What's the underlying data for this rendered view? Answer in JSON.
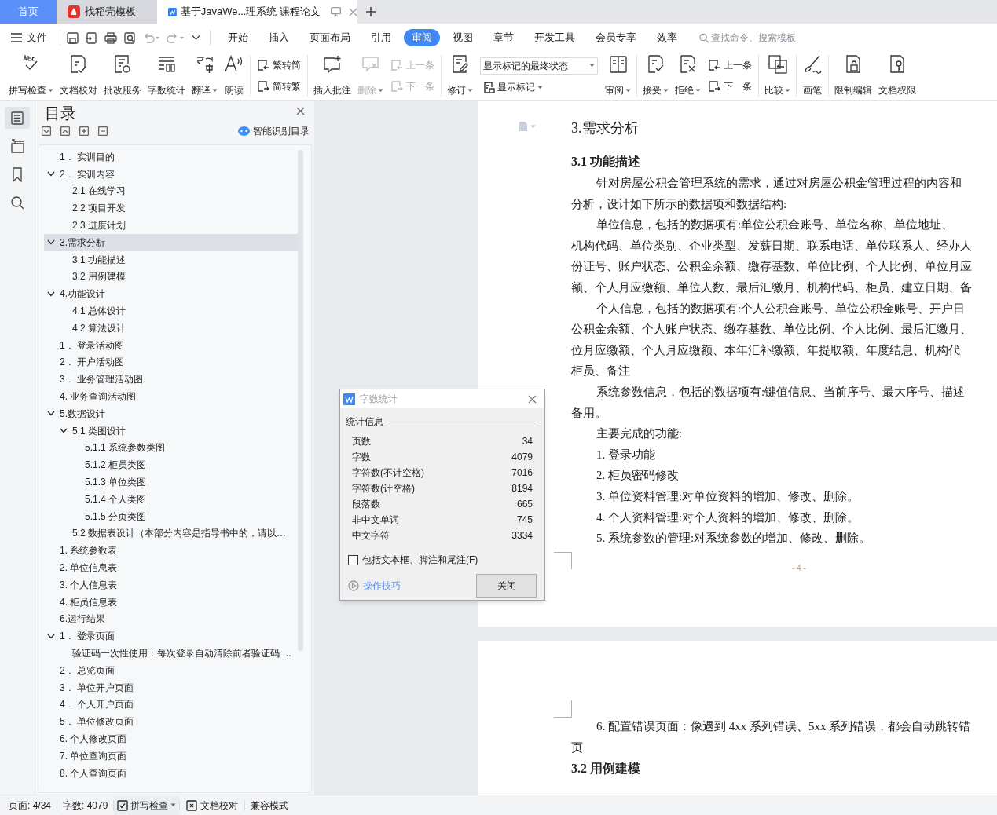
{
  "tabs": [
    {
      "label": "首页",
      "kind": "home",
      "selected": false
    },
    {
      "label": "找稻壳模板",
      "kind": "docer",
      "selected": false
    },
    {
      "label": "基于JavaWe...理系统 课程论文",
      "kind": "document",
      "selected": true
    }
  ],
  "menu": {
    "file": "文件",
    "tabs": [
      {
        "label": "开始",
        "selected": false
      },
      {
        "label": "插入",
        "selected": false
      },
      {
        "label": "页面布局",
        "selected": false
      },
      {
        "label": "引用",
        "selected": false
      },
      {
        "label": "审阅",
        "selected": true
      },
      {
        "label": "视图",
        "selected": false
      },
      {
        "label": "章节",
        "selected": false
      },
      {
        "label": "开发工具",
        "selected": false
      },
      {
        "label": "会员专享",
        "selected": false
      },
      {
        "label": "效率",
        "selected": false
      }
    ],
    "search": {
      "placeholder": "查找命令、搜索模板"
    }
  },
  "ribbon": [
    [
      {
        "kind": "big",
        "label": "拼写检查",
        "dropdown": true,
        "disabled": false
      },
      {
        "kind": "big",
        "label": "文档校对",
        "dropdown": false,
        "disabled": false
      },
      {
        "kind": "big",
        "label": "批改服务",
        "dropdown": false,
        "disabled": false
      },
      {
        "kind": "big",
        "label": "字数统计",
        "dropdown": false,
        "disabled": false
      },
      {
        "kind": "big",
        "label": "翻译",
        "dropdown": true,
        "disabled": false
      },
      {
        "kind": "big",
        "label": "朗读",
        "dropdown": false,
        "disabled": false
      }
    ],
    [
      {
        "kind": "pair",
        "items": [
          {
            "label": "繁转简",
            "disabled": false
          },
          {
            "label": "简转繁",
            "disabled": false
          }
        ]
      }
    ],
    [
      {
        "kind": "big",
        "label": "插入批注",
        "dropdown": false,
        "disabled": false
      },
      {
        "kind": "big",
        "label": "删除",
        "dropdown": true,
        "disabled": true
      },
      {
        "kind": "pair",
        "items": [
          {
            "label": "上一条",
            "disabled": true
          },
          {
            "label": "下一条",
            "disabled": true
          }
        ]
      }
    ],
    [
      {
        "kind": "big",
        "label": "修订",
        "dropdown": true,
        "disabled": false
      },
      {
        "kind": "select",
        "value": "显示标记的最终状态",
        "below": {
          "label": "显示标记",
          "dropdown": true
        }
      },
      {
        "kind": "big",
        "label": "审阅",
        "dropdown": true,
        "disabled": false
      }
    ],
    [
      {
        "kind": "big",
        "label": "接受",
        "dropdown": true,
        "disabled": false
      },
      {
        "kind": "big",
        "label": "拒绝",
        "dropdown": true,
        "disabled": false
      },
      {
        "kind": "pair",
        "items": [
          {
            "label": "上一条",
            "disabled": false
          },
          {
            "label": "下一条",
            "disabled": false
          }
        ]
      }
    ],
    [
      {
        "kind": "big",
        "label": "比较",
        "dropdown": true,
        "disabled": false
      }
    ],
    [
      {
        "kind": "big",
        "label": "画笔",
        "dropdown": false,
        "disabled": false
      }
    ],
    [
      {
        "kind": "big",
        "label": "限制编辑",
        "dropdown": false,
        "disabled": false
      },
      {
        "kind": "big",
        "label": "文档权限",
        "dropdown": false,
        "disabled": false
      }
    ]
  ],
  "nav_rail": [
    {
      "selected": true
    },
    {
      "selected": false
    },
    {
      "selected": false
    },
    {
      "selected": false
    }
  ],
  "toc": {
    "title": "目录",
    "smart_button": "智能识别目录",
    "items": [
      {
        "label": "1． 实训目的",
        "selected": false
      },
      {
        "label": "2． 实训内容",
        "selected": false,
        "expanded": true,
        "children": [
          {
            "label": "2.1 在线学习",
            "selected": false
          },
          {
            "label": "2.2 项目开发",
            "selected": false
          },
          {
            "label": "2.3 进度计划",
            "selected": false
          }
        ]
      },
      {
        "label": "3.需求分析",
        "selected": true,
        "expanded": true,
        "children": [
          {
            "label": "3.1 功能描述",
            "selected": false
          },
          {
            "label": "3.2 用例建模",
            "selected": false
          }
        ]
      },
      {
        "label": "4.功能设计",
        "selected": false,
        "expanded": true,
        "children": [
          {
            "label": "4.1 总体设计",
            "selected": false
          },
          {
            "label": "4.2 算法设计",
            "selected": false
          }
        ]
      },
      {
        "label": "1． 登录活动图",
        "selected": false
      },
      {
        "label": "2． 开户活动图",
        "selected": false
      },
      {
        "label": "3． 业务管理活动图",
        "selected": false
      },
      {
        "label": "4. 业务查询活动图",
        "selected": false
      },
      {
        "label": "5.数据设计",
        "selected": false,
        "expanded": true,
        "children": [
          {
            "label": "5.1 类图设计",
            "selected": false,
            "expanded": true,
            "children": [
              {
                "label": "5.1.1 系统参数类图",
                "selected": false
              },
              {
                "label": "5.1.2 柜员类图",
                "selected": false
              },
              {
                "label": "5.1.3 单位类图",
                "selected": false
              },
              {
                "label": "5.1.4 个人类图",
                "selected": false
              },
              {
                "label": "5.1.5 分页类图",
                "selected": false
              }
            ]
          },
          {
            "label": "5.2 数据表设计（本部分内容是指导书中的，请以…",
            "selected": false
          }
        ]
      },
      {
        "label": "1. 系统参数表",
        "selected": false
      },
      {
        "label": "2. 单位信息表",
        "selected": false
      },
      {
        "label": "3. 个人信息表",
        "selected": false
      },
      {
        "label": "4. 柜员信息表",
        "selected": false
      },
      {
        "label": "6.运行结果",
        "selected": false
      },
      {
        "label": "1． 登录页面",
        "selected": false,
        "expanded": true,
        "children": [
          {
            "label": "验证码一次性使用：每次登录自动清除前者验证码 …",
            "selected": false
          }
        ]
      },
      {
        "label": "2． 总览页面",
        "selected": false
      },
      {
        "label": "3． 单位开户页面",
        "selected": false
      },
      {
        "label": "4． 个人开户页面",
        "selected": false
      },
      {
        "label": "5． 单位修改页面",
        "selected": false
      },
      {
        "label": "6. 个人修改页面",
        "selected": false
      },
      {
        "label": "7. 单位查询页面",
        "selected": false
      },
      {
        "label": "8. 个人查询页面",
        "selected": false
      }
    ]
  },
  "document": {
    "pages": [
      {
        "footer": "- 4 -",
        "blocks": [
          {
            "kind": "chapter",
            "text": "3.需求分析"
          },
          {
            "kind": "section",
            "number": "3.1",
            "text": "功能描述"
          },
          {
            "kind": "first_line",
            "text": "针对房屋公积金管理系统的需求，通过对房屋公积金管理过程的内容和"
          },
          {
            "kind": "line",
            "text": "分析，设计如下所示的数据项和数据结构:"
          },
          {
            "kind": "first_line",
            "text": "单位信息，包括的数据项有:单位公积金账号、单位名称、单位地址、"
          },
          {
            "kind": "line",
            "text": "机构代码、单位类别、企业类型、发薪日期、联系电话、单位联系人、经办人"
          },
          {
            "kind": "line",
            "text": "份证号、账户状态、公积金余额、缴存基数、单位比例、个人比例、单位月应"
          },
          {
            "kind": "line",
            "text": "额、个人月应缴额、单位人数、最后汇缴月、机构代码、柜员、建立日期、备"
          },
          {
            "kind": "first_line",
            "text": "个人信息，包括的数据项有:个人公积金账号、单位公积金账号、开户日"
          },
          {
            "kind": "line",
            "text": "公积金余额、个人账户状态、缴存基数、单位比例、个人比例、最后汇缴月、"
          },
          {
            "kind": "line",
            "text": "位月应缴额、个人月应缴额、本年汇补缴额、年提取额、年度结息、机构代"
          },
          {
            "kind": "line",
            "text": "柜员、备注"
          },
          {
            "kind": "first_line",
            "text": "系统参数信息，包括的数据项有:键值信息、当前序号、最大序号、描述"
          },
          {
            "kind": "line",
            "text": "备用。"
          },
          {
            "kind": "first_line",
            "text": "主要完成的功能:"
          },
          {
            "kind": "list",
            "number": "1.",
            "text": "登录功能"
          },
          {
            "kind": "list",
            "number": "2.",
            "text": "柜员密码修改"
          },
          {
            "kind": "list",
            "number": "3.",
            "text": "单位资料管理:对单位资料的增加、修改、删除。"
          },
          {
            "kind": "list",
            "number": "4.",
            "text": "个人资料管理:对个人资料的增加、修改、删除。"
          },
          {
            "kind": "list",
            "number": "5.",
            "text": "系统参数的管理:对系统参数的增加、修改、删除。"
          }
        ]
      },
      {
        "blocks": [
          {
            "kind": "list",
            "number": "6.",
            "text": "配置错误页面：像遇到 4xx 系列错误、5xx 系列错误，都会自动跳转错"
          },
          {
            "kind": "line",
            "text": "页"
          },
          {
            "kind": "section",
            "number": "3.2",
            "text": "用例建模"
          }
        ]
      }
    ]
  },
  "dialog": {
    "title": "字数统计",
    "group": "统计信息",
    "rows": [
      {
        "label": "页数",
        "value": "34"
      },
      {
        "label": "字数",
        "value": "4079"
      },
      {
        "label": "字符数(不计空格)",
        "value": "7016"
      },
      {
        "label": "字符数(计空格)",
        "value": "8194"
      },
      {
        "label": "段落数",
        "value": "665"
      },
      {
        "label": "非中文单词",
        "value": "745"
      },
      {
        "label": "中文字符",
        "value": "3334"
      }
    ],
    "checkbox": {
      "label": "包括文本框、脚注和尾注(F)",
      "checked": false
    },
    "link": "操作技巧",
    "button": "关闭"
  },
  "status_bar": [
    {
      "kind": "text",
      "label": "页面: 4/34"
    },
    {
      "kind": "text",
      "label": "字数: 4079"
    },
    {
      "kind": "spell",
      "label": "拼写检查"
    },
    {
      "kind": "proof",
      "label": "文档校对"
    },
    {
      "kind": "text",
      "label": "兼容模式"
    }
  ]
}
